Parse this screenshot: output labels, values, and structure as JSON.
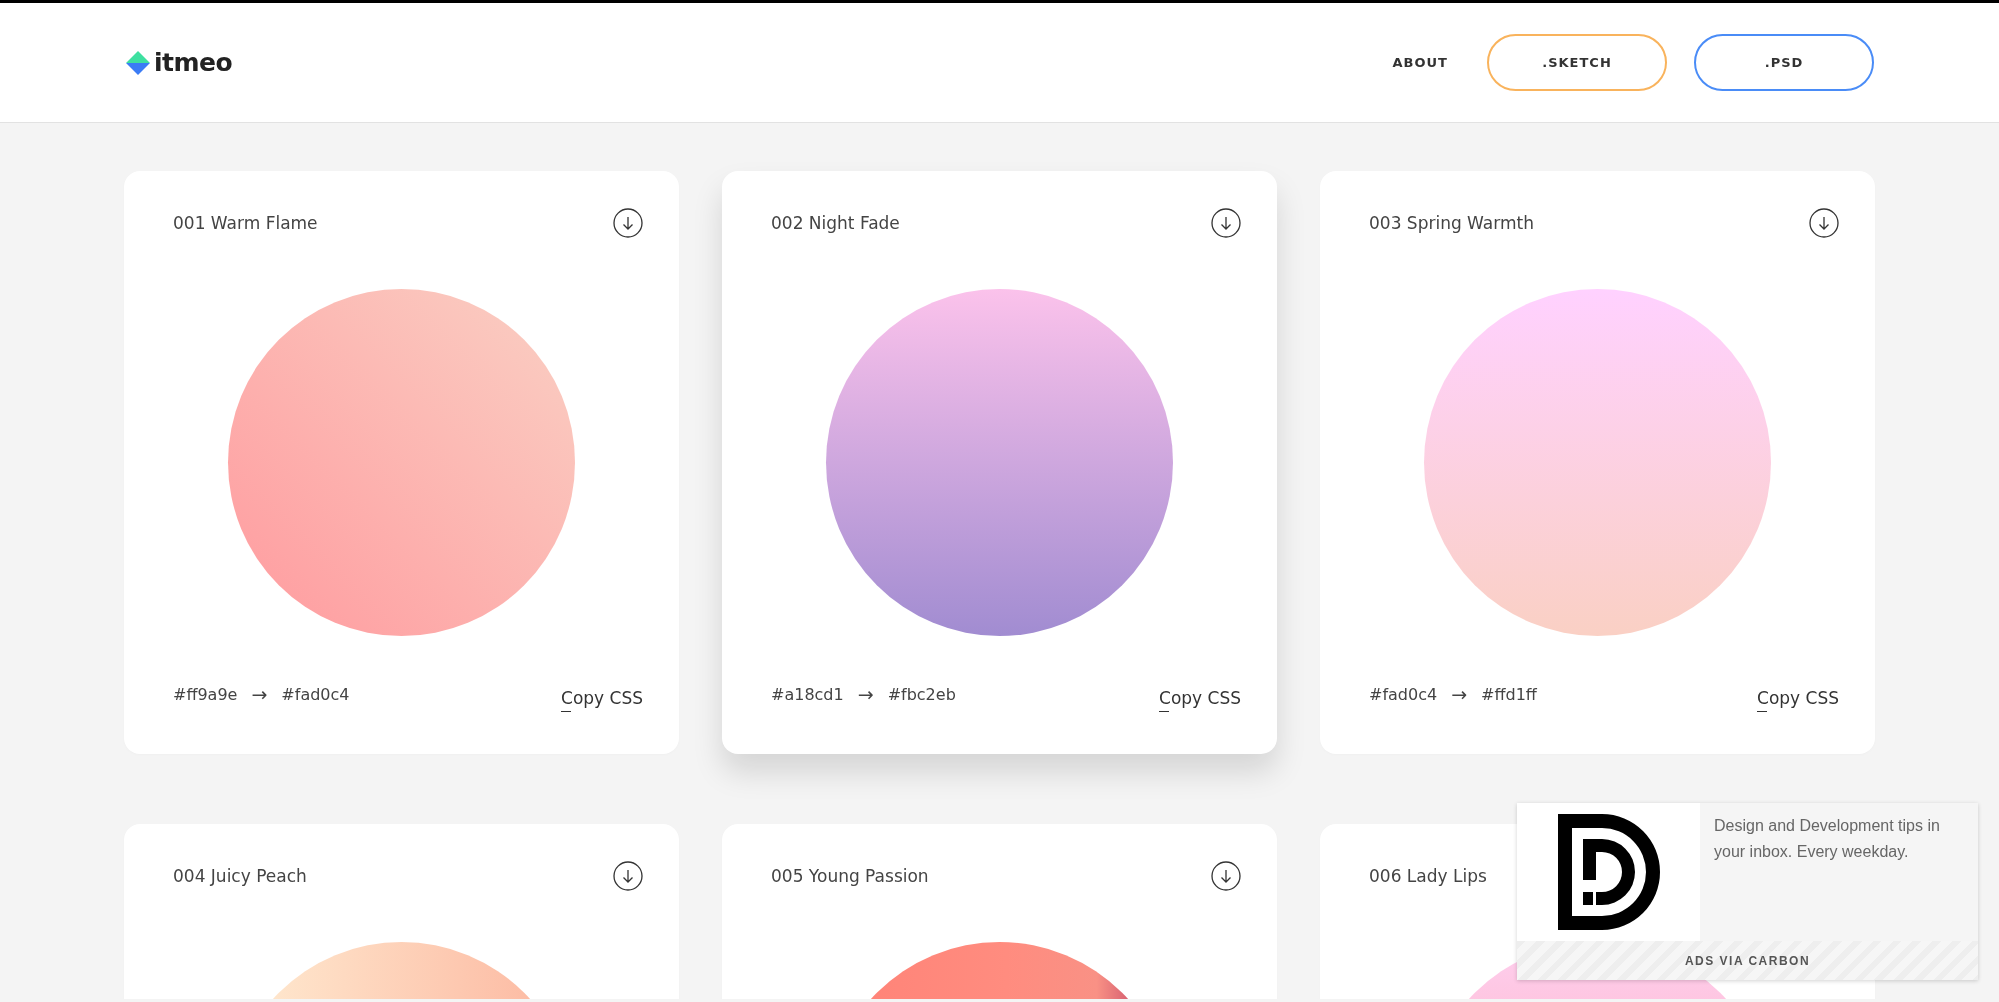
{
  "header": {
    "logo": "itmeo",
    "nav": [
      {
        "label": "ABOUT",
        "kind": "link"
      },
      {
        "label": ".SKETCH",
        "kind": "outline",
        "color": "#f9b35c"
      },
      {
        "label": ".PSD",
        "kind": "outline",
        "color": "#4a8cf7"
      }
    ]
  },
  "cards": [
    {
      "title": "001 Warm Flame",
      "download": true,
      "raised": false,
      "from": "#ff9a9e",
      "arrow": "→",
      "to": "#fad0c4",
      "action": "Copy CSS"
    },
    {
      "title": "002 Night Fade",
      "download": true,
      "raised": true,
      "from": "#a18cd1",
      "arrow": "→",
      "to": "#fbc2eb",
      "action": "Copy CSS"
    },
    {
      "title": "003 Spring Warmth",
      "download": true,
      "raised": false,
      "from": "#fad0c4",
      "arrow": "→",
      "to": "#ffd1ff",
      "action": "Copy CSS"
    },
    {
      "title": "004 Juicy Peach",
      "download": true,
      "raised": false
    },
    {
      "title": "005 Young Passion",
      "download": true,
      "raised": false
    },
    {
      "title": "006 Lady Lips",
      "download": false,
      "raised": false
    }
  ],
  "ad": {
    "text": "Design and Development tips in your inbox. Every weekday.",
    "footer": "ADS VIA CARBON"
  }
}
